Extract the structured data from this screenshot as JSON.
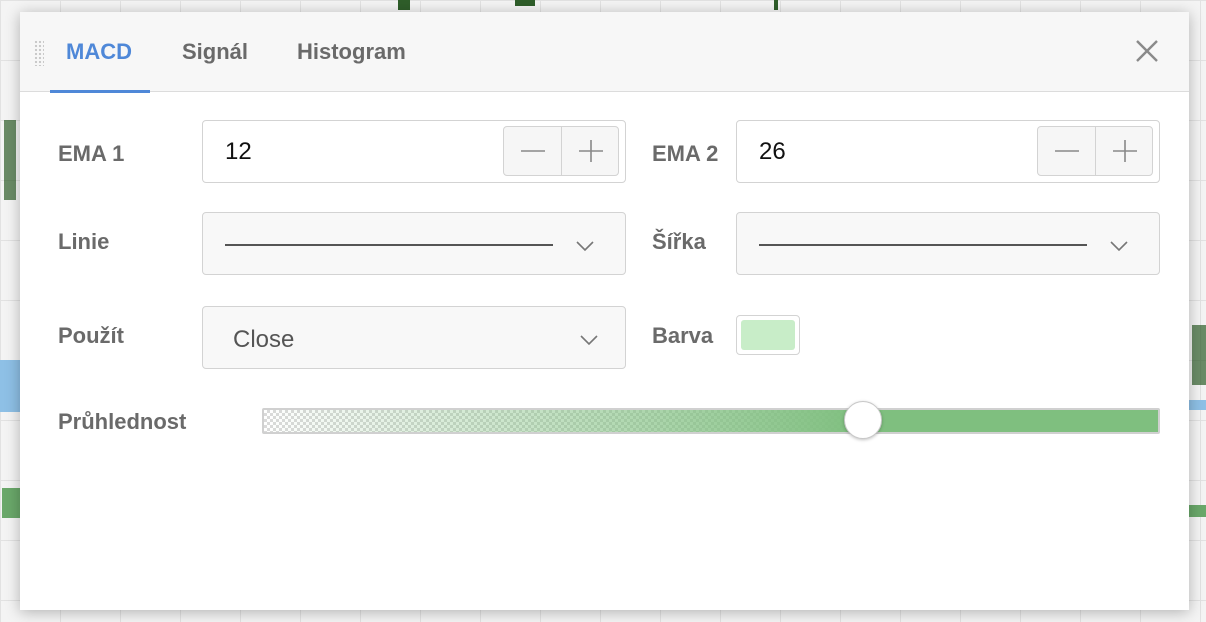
{
  "tabs": [
    {
      "label": "MACD",
      "active": true
    },
    {
      "label": "Signál",
      "active": false
    },
    {
      "label": "Histogram",
      "active": false
    }
  ],
  "icons": {
    "drag": "drag-handle-icon",
    "close": "close-icon",
    "minus": "minus-icon",
    "plus": "plus-icon",
    "dropdown": "chevron-down-icon"
  },
  "colors": {
    "accent": "#4f88d8",
    "label": "#6a6a6a",
    "swatch": "#c8edc8",
    "opacity_fill": "#7fbf7f"
  },
  "fields": {
    "ema1": {
      "label": "EMA 1",
      "value": "12"
    },
    "ema2": {
      "label": "EMA 2",
      "value": "26"
    },
    "line": {
      "label": "Linie"
    },
    "width": {
      "label": "Šířka"
    },
    "apply": {
      "label": "Použít",
      "value": "Close"
    },
    "color": {
      "label": "Barva"
    },
    "opacity": {
      "label": "Průhlednost",
      "value": 0.67
    }
  }
}
